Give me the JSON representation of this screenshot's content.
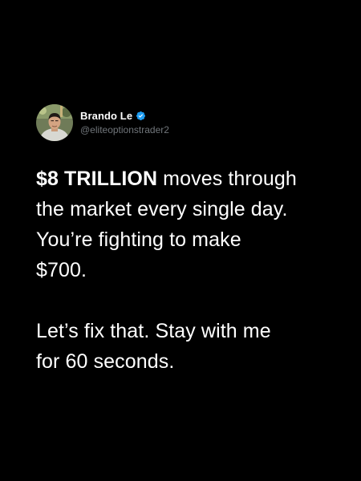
{
  "author": {
    "display_name": "Brando Le",
    "handle": "@eliteoptionstrader2",
    "avatar_icon": "profile-photo",
    "verified_icon": "verified-badge-icon",
    "verified_color": "#1d9bf0"
  },
  "post": {
    "paragraph1": {
      "bold_lead": "$8 TRILLION",
      "rest_line1": " moves through",
      "line2": "the market every single day.",
      "line3": "You’re fighting to make",
      "line4": "$700."
    },
    "paragraph2": {
      "line1": "Let’s fix that. Stay with me",
      "line2": "for 60 seconds."
    }
  },
  "colors": {
    "background": "#000000",
    "text": "#ffffff",
    "handle": "#71767b"
  }
}
